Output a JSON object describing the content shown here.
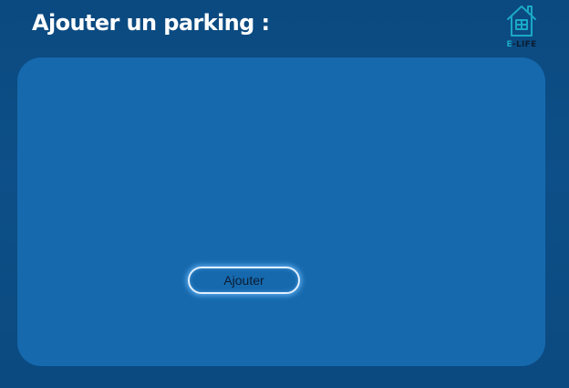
{
  "header": {
    "title": "Ajouter un parking :"
  },
  "logo": {
    "icon": "house-icon",
    "text_prefix": "E",
    "text_rest": "-LIFE",
    "accent_color": "#1aa8c7"
  },
  "form": {
    "submit_label": "Ajouter"
  },
  "colors": {
    "background": "#0b4a80",
    "card": "#1669ad",
    "button_glow": "#6ebeff"
  }
}
